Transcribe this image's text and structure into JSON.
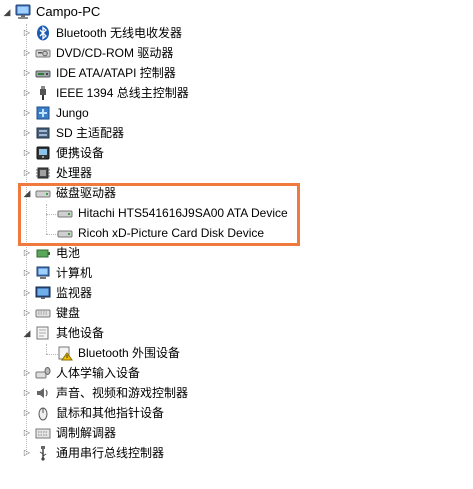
{
  "root": {
    "label": "Campo-PC",
    "icon": "computer-icon"
  },
  "categories": [
    {
      "label": "Bluetooth 无线电收发器",
      "icon": "bluetooth-icon"
    },
    {
      "label": "DVD/CD-ROM 驱动器",
      "icon": "dvd-drive-icon"
    },
    {
      "label": "IDE ATA/ATAPI 控制器",
      "icon": "ide-controller-icon"
    },
    {
      "label": "IEEE 1394 总线主控制器",
      "icon": "ieee1394-icon"
    },
    {
      "label": "Jungo",
      "icon": "jungo-icon"
    },
    {
      "label": "SD 主适配器",
      "icon": "sd-adapter-icon"
    },
    {
      "label": "便携设备",
      "icon": "portable-device-icon"
    },
    {
      "label": "处理器",
      "icon": "processor-icon"
    },
    {
      "label": "磁盘驱动器",
      "icon": "disk-drive-icon"
    },
    {
      "label": "电池",
      "icon": "battery-icon"
    },
    {
      "label": "计算机",
      "icon": "computer-category-icon"
    },
    {
      "label": "监视器",
      "icon": "monitor-icon"
    },
    {
      "label": "键盘",
      "icon": "keyboard-icon"
    },
    {
      "label": "其他设备",
      "icon": "other-devices-icon"
    },
    {
      "label": "人体学输入设备",
      "icon": "hid-icon"
    },
    {
      "label": "声音、视频和游戏控制器",
      "icon": "sound-icon"
    },
    {
      "label": "鼠标和其他指针设备",
      "icon": "mouse-icon"
    },
    {
      "label": "调制解调器",
      "icon": "modem-icon"
    },
    {
      "label": "通用串行总线控制器",
      "icon": "usb-icon"
    }
  ],
  "disk_children": [
    {
      "label": "Hitachi HTS541616J9SA00 ATA Device",
      "icon": "hard-disk-icon"
    },
    {
      "label": "Ricoh xD-Picture Card Disk Device",
      "icon": "hard-disk-icon"
    }
  ],
  "other_children": [
    {
      "label": "Bluetooth 外围设备",
      "icon": "warning-device-icon"
    }
  ],
  "colors": {
    "highlight_border": "#f07a3e",
    "tree_lines": "#b8b8b8"
  }
}
